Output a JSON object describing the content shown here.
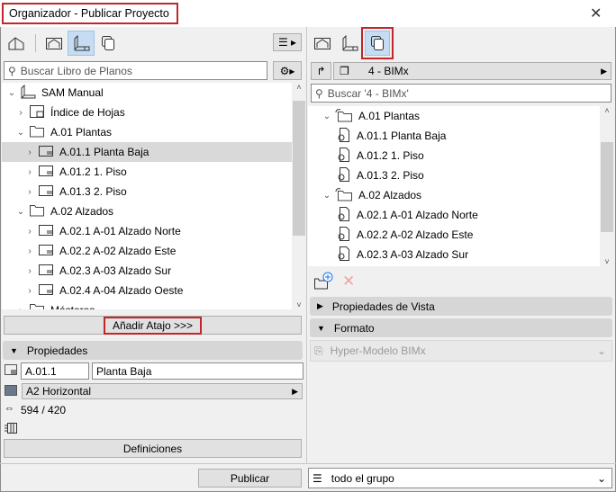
{
  "window": {
    "title": "Organizador - Publicar Proyecto"
  },
  "left": {
    "search_placeholder": "Buscar Libro de Planos",
    "tree": [
      {
        "label": "SAM Manual",
        "level": 0,
        "expanded": true,
        "icon": "book-icon"
      },
      {
        "label": "Índice de Hojas",
        "level": 1,
        "icon": "index-icon"
      },
      {
        "label": "A.01 Plantas",
        "level": 1,
        "expanded": true,
        "icon": "folder-icon"
      },
      {
        "label": "A.01.1 Planta Baja",
        "level": 2,
        "icon": "sheet-icon",
        "selected": true
      },
      {
        "label": "A.01.2 1. Piso",
        "level": 2,
        "icon": "sheet-icon"
      },
      {
        "label": "A.01.3 2. Piso",
        "level": 2,
        "icon": "sheet-icon"
      },
      {
        "label": "A.02 Alzados",
        "level": 1,
        "expanded": true,
        "icon": "folder-icon"
      },
      {
        "label": "A.02.1 A-01 Alzado Norte",
        "level": 2,
        "icon": "sheet-icon"
      },
      {
        "label": "A.02.2 A-02 Alzado Este",
        "level": 2,
        "icon": "sheet-icon"
      },
      {
        "label": "A.02.3 A-03 Alzado Sur",
        "level": 2,
        "icon": "sheet-icon"
      },
      {
        "label": "A.02.4 A-04 Alzado Oeste",
        "level": 2,
        "icon": "sheet-icon"
      },
      {
        "label": "Másteros",
        "level": 1,
        "icon": "folder-icon"
      }
    ],
    "add_shortcut": "Añadir Atajo >>>",
    "properties": {
      "title": "Propiedades",
      "id": "A.01.1",
      "name": "Planta Baja",
      "format": "A2 Horizontal",
      "size": "594 / 420",
      "definitions": "Definiciones"
    }
  },
  "right": {
    "set_name": "4 - BIMx",
    "search_placeholder": "Buscar '4 - BIMx'",
    "tree": [
      {
        "label": "A.01 Plantas",
        "level": 0,
        "folder": true
      },
      {
        "label": "A.01.1 Planta Baja",
        "level": 1
      },
      {
        "label": "A.01.2 1. Piso",
        "level": 1
      },
      {
        "label": "A.01.3 2. Piso",
        "level": 1
      },
      {
        "label": "A.02 Alzados",
        "level": 0,
        "folder": true
      },
      {
        "label": "A.02.1 A-01 Alzado Norte",
        "level": 1
      },
      {
        "label": "A.02.2 A-02 Alzado Este",
        "level": 1
      },
      {
        "label": "A.02.3 A-03 Alzado Sur",
        "level": 1
      }
    ],
    "view_props": "Propiedades de Vista",
    "format_title": "Formato",
    "format_value": "Hyper-Modelo BIMx"
  },
  "footer": {
    "publish": "Publicar",
    "scope": "todo el grupo"
  }
}
